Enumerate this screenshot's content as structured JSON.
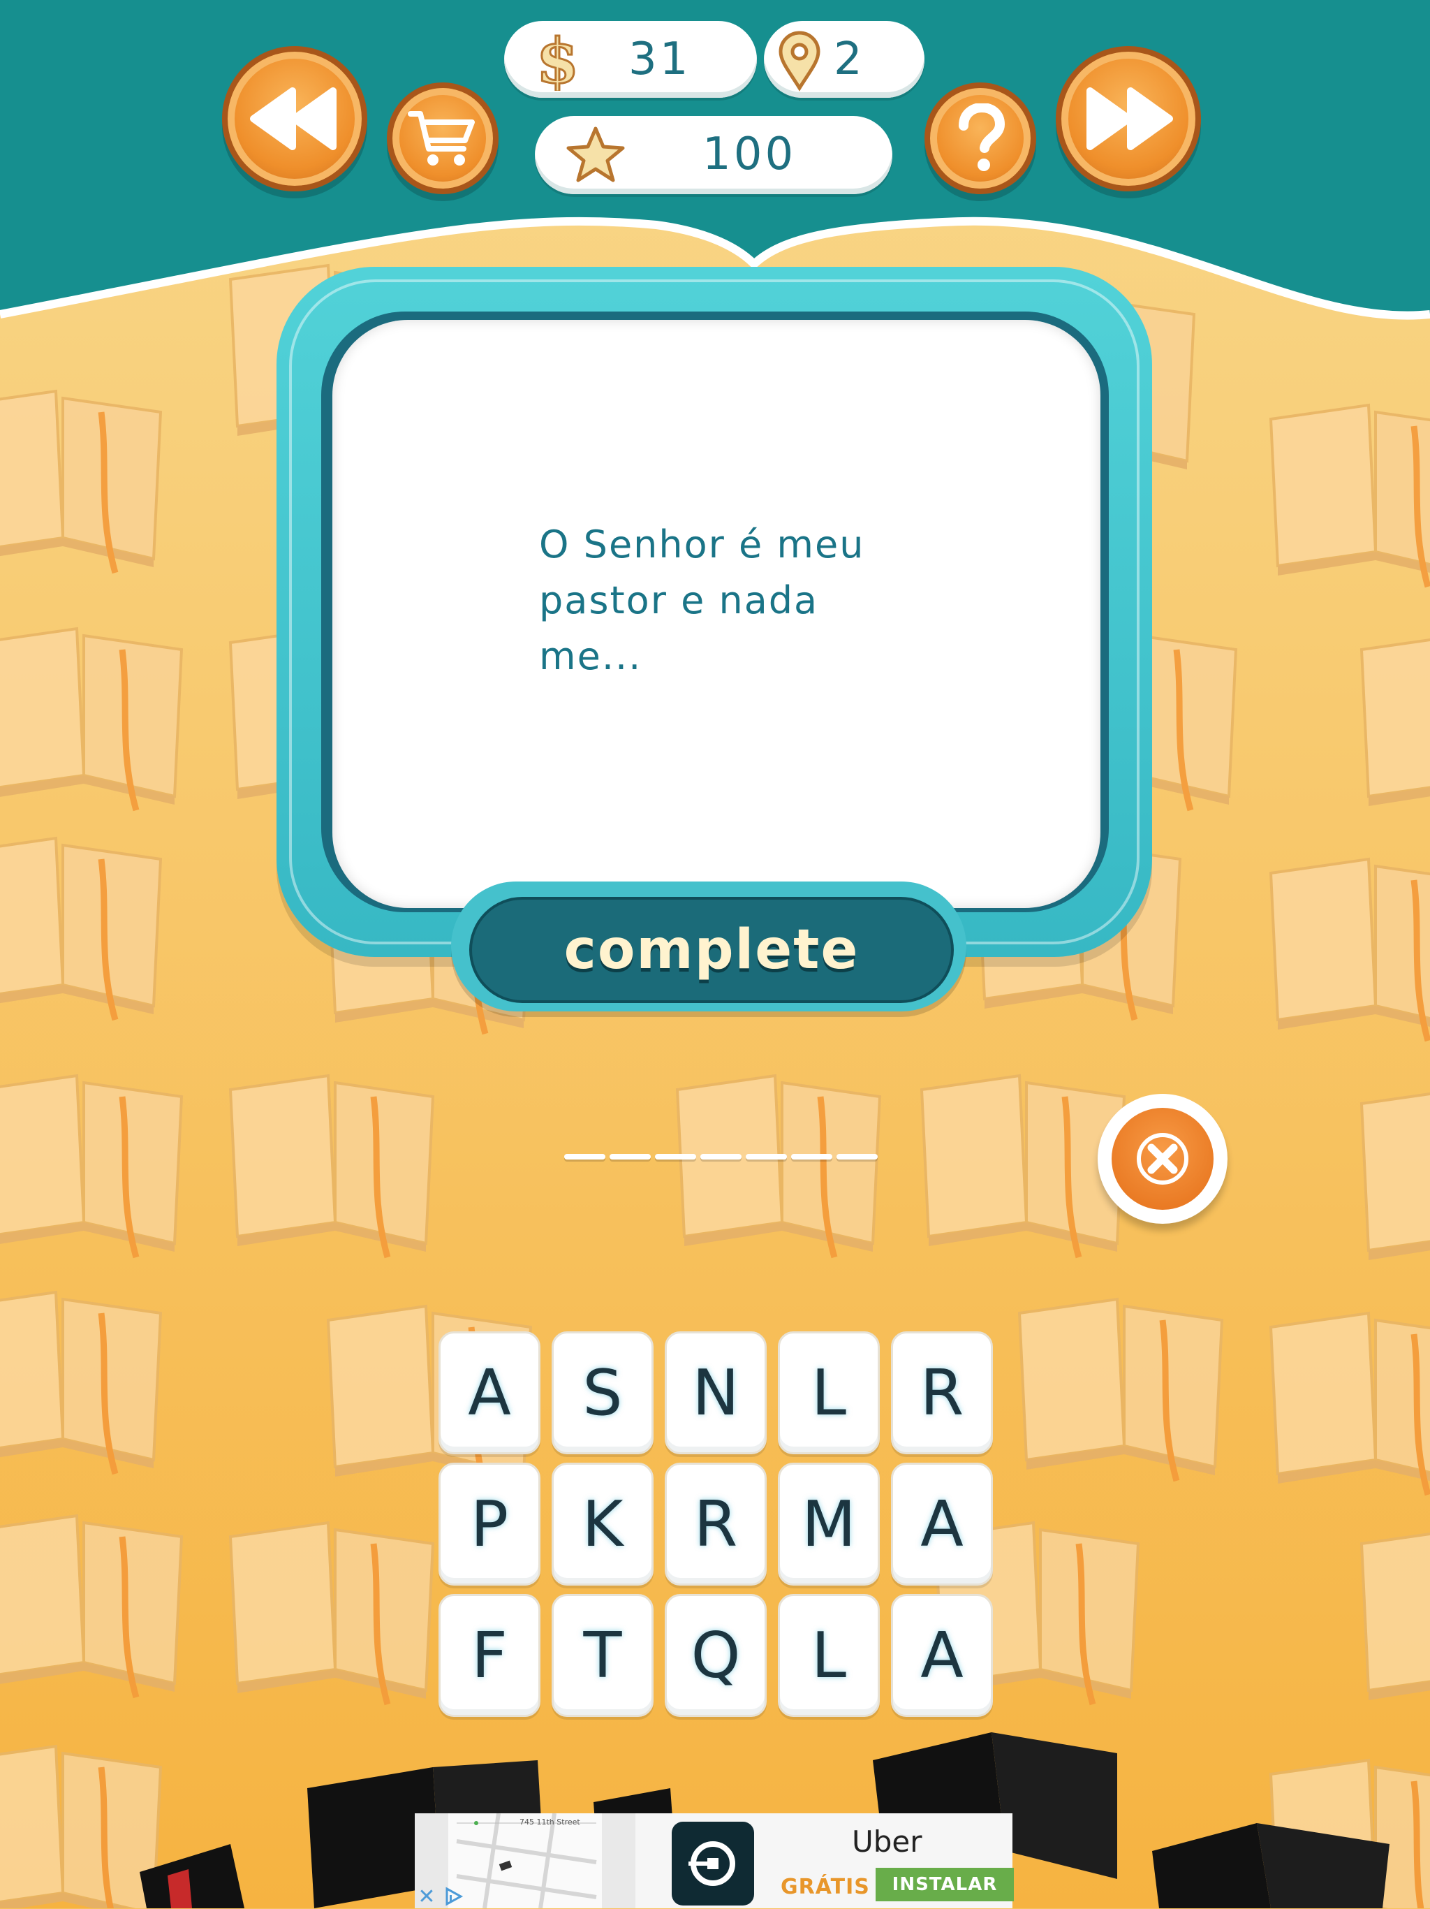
{
  "header": {
    "coins": "31",
    "level": "2",
    "stars": "100",
    "buttons": {
      "previous": "rewind-icon",
      "shop": "cart-icon",
      "help": "question-icon",
      "next": "fast-forward-icon"
    }
  },
  "question": {
    "text": "O Senhor é meu pastor e nada me...",
    "mode_label": "complete"
  },
  "answer": {
    "slot_count": 7,
    "filled": ""
  },
  "letters": [
    "A",
    "S",
    "N",
    "L",
    "R",
    "P",
    "K",
    "R",
    "M",
    "A",
    "F",
    "T",
    "Q",
    "L",
    "A"
  ],
  "ad": {
    "street_label": "745 11th Street",
    "title": "Uber",
    "free_label": "GRÁTIS",
    "install_label": "INSTALAR"
  },
  "colors": {
    "header_teal": "#1a9090",
    "background_yellow": "#f8c25c",
    "orange_button": "#ef8f2b",
    "card_frame": "#42c3cc",
    "text_teal": "#1a7487"
  }
}
